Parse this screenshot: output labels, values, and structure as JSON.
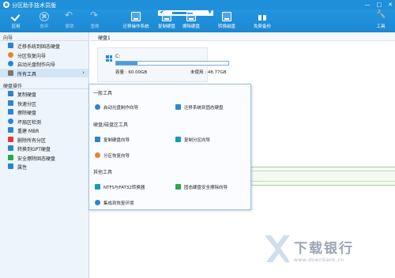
{
  "app": {
    "title": "分区助手技术员版",
    "brand_color": "#1e8fd8"
  },
  "window_controls": {
    "minimize": "—",
    "maximize": "□",
    "close": "✕"
  },
  "toolbar": {
    "apply": "应用",
    "discard": "放弃",
    "undo": "撤销",
    "redo": "重做",
    "migrate_os": "迁移操作系统",
    "copy_disk": "复制硬盘",
    "wipe_disk": "擦除硬盘",
    "convert_disk": "转换磁盘",
    "free_backup": "免费备份",
    "tools": "工具"
  },
  "sidebar": {
    "wizard_header": "向导",
    "wizard_items": [
      "迁移系统到固态硬盘",
      "分区恢复向导",
      "启动光盘制作向导",
      "所有工具"
    ],
    "disk_ops_header": "硬盘操作",
    "disk_items": [
      "复制硬盘",
      "快速分区",
      "擦除硬盘",
      "坏扇区检测",
      "重建 MBR",
      "删除所有分区",
      "转换到GPT硬盘",
      "安全擦除固态硬盘",
      "属性"
    ]
  },
  "main": {
    "disk_label": "硬盘1",
    "partition": {
      "drive": "C:",
      "capacity": "容量 : 60.00GB",
      "unused": "未使用 : 48.77GB",
      "used_fraction": 0.19
    }
  },
  "popup": {
    "general_header": "一般工具",
    "general_items": [
      "启动光盘制作向导",
      "迁移系统到固态硬盘"
    ],
    "disk_tools_header": "硬盘/磁盘区工具",
    "disk_tools_items": [
      "复制硬盘向导",
      "复制分区向导",
      "分区恢复向导"
    ],
    "other_header": "其他工具",
    "other_items": [
      "NTFS与FAT32转换器",
      "固态硬盘安全擦除向导",
      "集成到恢复环境"
    ]
  },
  "watermark": {
    "text": "下载银行",
    "url": "www.downbank.cn"
  }
}
